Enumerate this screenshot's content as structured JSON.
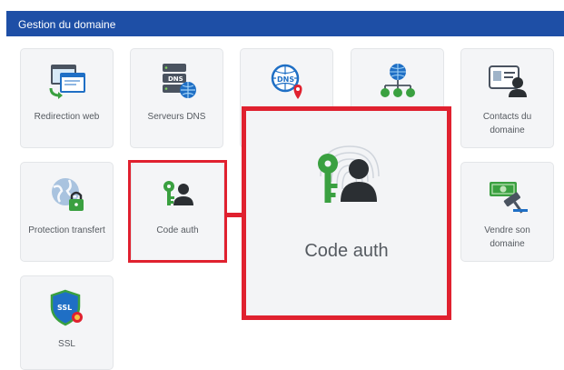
{
  "header": {
    "title": "Gestion du domaine"
  },
  "tiles": {
    "redirection": {
      "label": "Redirection web",
      "icon": "browser-redirect-icon"
    },
    "dns_servers": {
      "label": "Serveurs DNS",
      "icon": "dns-server-icon"
    },
    "dns_zone": {
      "label": "",
      "icon": "dns-globe-pin-icon"
    },
    "dns_network": {
      "label": "",
      "icon": "globe-network-icon"
    },
    "contacts": {
      "label": "Contacts du domaine",
      "icon": "contact-card-icon"
    },
    "protection": {
      "label": "Protection transfert",
      "icon": "globe-lock-icon"
    },
    "auth_code": {
      "label": "Code auth",
      "icon": "key-user-icon"
    },
    "sell": {
      "label": "Vendre son domaine",
      "icon": "money-gavel-icon"
    },
    "ssl": {
      "label": "SSL",
      "icon": "ssl-shield-icon"
    }
  },
  "zoom": {
    "label": "Code auth",
    "icon": "key-user-fingerprint-icon"
  },
  "colors": {
    "header": "#1e4fa6",
    "highlight": "#e0212f",
    "key_green": "#3aa040",
    "tile_bg": "#f4f5f7"
  }
}
